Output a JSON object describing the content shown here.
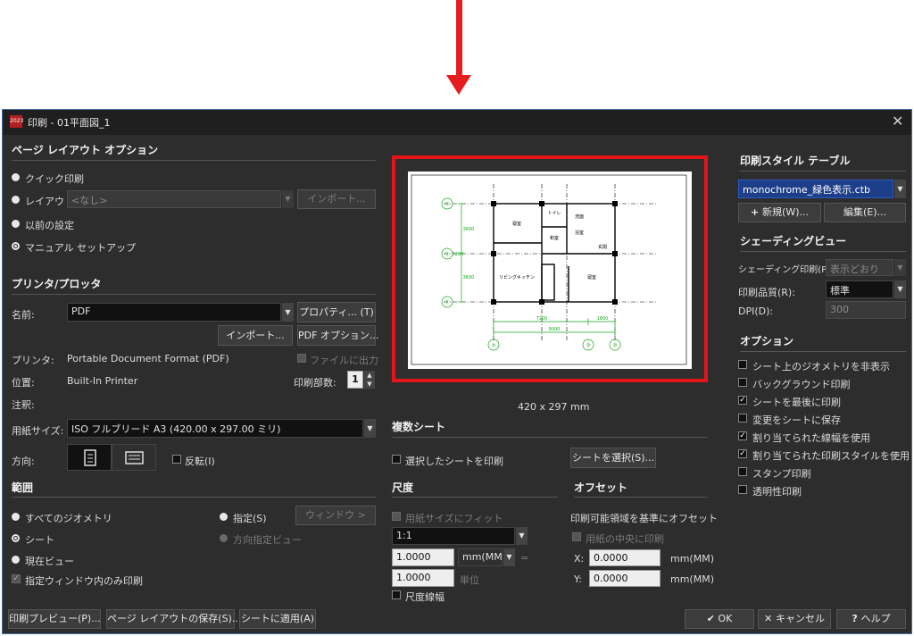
{
  "window": {
    "title": "印刷 - 01平面図_1",
    "app_icon_text": "2023"
  },
  "page_layout": {
    "heading": "ページ レイアウト オプション",
    "quick_print": "クイック印刷",
    "layout_label": "レイアウト:",
    "layout_value": "<なし>",
    "import_label": "インポート...",
    "previous_settings": "以前の設定",
    "manual_setup": "マニュアル セットアップ"
  },
  "printer": {
    "heading": "プリンタ/プロッタ",
    "name_label": "名前:",
    "name_value": "PDF",
    "properties_button": "プロパティ... (T)",
    "import_button": "インポート...",
    "pdf_options_button": "PDF オプション...",
    "printer_label": "プリンタ:",
    "printer_value": "Portable Document Format (PDF)",
    "print_to_file": "ファイルに出力",
    "location_label": "位置:",
    "location_value": "Built-In Printer",
    "copies_label": "印刷部数:",
    "copies_value": "1",
    "comment_label": "注釈:",
    "paper_size_label": "用紙サイズ:",
    "paper_size_value": "ISO フルブリード A3 (420.00 x 297.00 ミリ)",
    "orientation_label": "方向:",
    "reverse_label": "反転(I)"
  },
  "range": {
    "heading": "範囲",
    "all_geometry": "すべてのジオメトリ",
    "specified": "指定(S)",
    "window_button": "ウィンドウ >",
    "sheet": "シート",
    "direction_view": "方向指定ビュー",
    "current_view": "現在ビュー",
    "window_only": "指定ウィンドウ内のみ印刷"
  },
  "preview": {
    "size_text": "420 x 297 mm",
    "plan_labels": {
      "grid_a": "⑬",
      "grid_b": "⑫",
      "grid_c": "⑪",
      "grid_d": "⑩",
      "grid_e": "⑳",
      "grid_f": "⑳",
      "room_1": "寝室",
      "room_2": "和室",
      "room_3": "洗面",
      "room_4": "浴室",
      "room_5": "トイレ",
      "room_6": "玄関",
      "room_7": "リビングキッチン",
      "room_8": "寝室",
      "dim_1": "7200",
      "dim_2": "1800",
      "dim_3": "9000",
      "dim_v1": "3600",
      "dim_v2": "7200",
      "dim_v3": "3600"
    }
  },
  "multi_sheet": {
    "heading": "複数シート",
    "print_selected": "選択したシートを印刷",
    "select_sheets_button": "シートを選択(S)..."
  },
  "scale": {
    "heading": "尺度",
    "fit_to_paper": "用紙サイズにフィット",
    "scale_value": "1:1",
    "value1": "1.0000",
    "unit_value": "mm(MM)",
    "equals": "=",
    "value2": "1.0000",
    "unit_label": "単位",
    "scale_lineweight": "尺度線幅"
  },
  "offset": {
    "heading": "オフセット",
    "printable_area_label": "印刷可能領域を基準にオフセット",
    "center_on_paper": "用紙の中央に印刷",
    "x_label": "X:",
    "x_value": "0.0000",
    "x_unit": "mm(MM)",
    "y_label": "Y:",
    "y_value": "0.0000",
    "y_unit": "mm(MM)"
  },
  "plot_style": {
    "heading": "印刷スタイル テーブル",
    "table_value": "monochrome_緑色表示.ctb",
    "new_button": "新規(W)...",
    "edit_button": "編集(E)..."
  },
  "shaded_view": {
    "heading": "シェーディングビュー",
    "shaded_plot_label": "シェーディング印刷(P)",
    "shaded_plot_value": "表示どおり",
    "quality_label": "印刷品質(R):",
    "quality_value": "標準",
    "dpi_label": "DPI(D):",
    "dpi_value": "300"
  },
  "options": {
    "heading": "オプション",
    "items": [
      {
        "label": "シート上のジオメトリを非表示",
        "checked": false
      },
      {
        "label": "バックグラウンド印刷",
        "checked": false
      },
      {
        "label": "シートを最後に印刷",
        "checked": true
      },
      {
        "label": "変更をシートに保存",
        "checked": false
      },
      {
        "label": "割り当てられた線幅を使用",
        "checked": true
      },
      {
        "label": "割り当てられた印刷スタイルを使用",
        "checked": true
      },
      {
        "label": "スタンプ印刷",
        "checked": false
      },
      {
        "label": "透明性印刷",
        "checked": false
      }
    ]
  },
  "footer": {
    "print_preview": "印刷プレビュー(P)...",
    "save_layout": "ページ レイアウトの保存(S)...",
    "apply_to_sheet": "シートに適用(A)",
    "ok": "OK",
    "cancel": "キャンセル",
    "help": "ヘルプ"
  },
  "colors": {
    "accent_red": "#e0161b",
    "selection_blue": "#1d3f8a",
    "dialog_bg": "#2d2d2d"
  }
}
